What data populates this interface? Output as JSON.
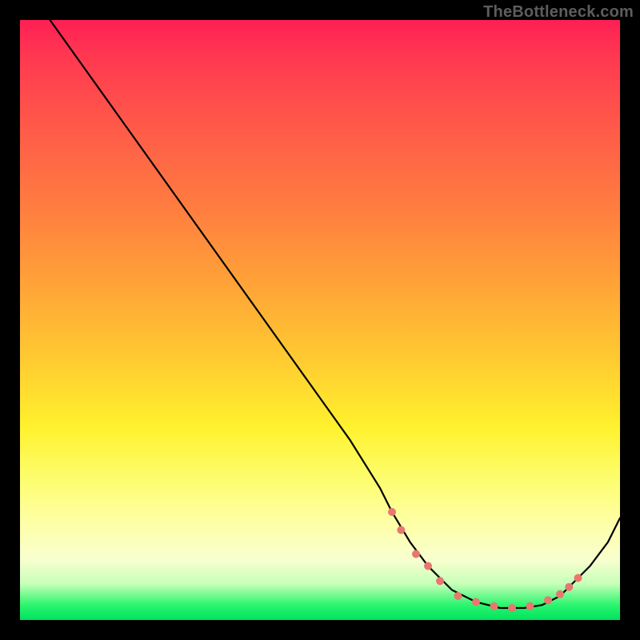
{
  "watermark": "TheBottleneck.com",
  "chart_data": {
    "type": "line",
    "title": "",
    "xlabel": "",
    "ylabel": "",
    "xlim": [
      0,
      100
    ],
    "ylim": [
      0,
      100
    ],
    "grid": false,
    "legend": null,
    "series": [
      {
        "name": "bottleneck-curve",
        "color": "#000000",
        "x": [
          5,
          10,
          15,
          20,
          25,
          30,
          35,
          40,
          45,
          50,
          55,
          60,
          62,
          65,
          68,
          72,
          76,
          80,
          84,
          87,
          90,
          92,
          95,
          98,
          100
        ],
        "y": [
          100,
          93,
          86,
          79,
          72,
          65,
          58,
          51,
          44,
          37,
          30,
          22,
          18,
          13,
          9,
          5,
          3,
          2,
          2,
          2.5,
          4,
          6,
          9,
          13,
          17
        ]
      }
    ],
    "markers": [
      {
        "name": "bottleneck-range-dots",
        "color": "#e8776f",
        "points": [
          {
            "x": 62,
            "y": 18
          },
          {
            "x": 63.5,
            "y": 15
          },
          {
            "x": 66,
            "y": 11
          },
          {
            "x": 68,
            "y": 9
          },
          {
            "x": 70,
            "y": 6.5
          },
          {
            "x": 73,
            "y": 4
          },
          {
            "x": 76,
            "y": 3
          },
          {
            "x": 79,
            "y": 2.3
          },
          {
            "x": 82,
            "y": 2
          },
          {
            "x": 85,
            "y": 2.3
          },
          {
            "x": 88,
            "y": 3.3
          },
          {
            "x": 90,
            "y": 4.3
          },
          {
            "x": 91.5,
            "y": 5.5
          },
          {
            "x": 93,
            "y": 7
          }
        ]
      }
    ],
    "background_gradient": {
      "orientation": "vertical",
      "stops": [
        {
          "pos": 0.0,
          "color": "#ff1f55"
        },
        {
          "pos": 0.32,
          "color": "#ff7f3f"
        },
        {
          "pos": 0.58,
          "color": "#ffcf30"
        },
        {
          "pos": 0.84,
          "color": "#feffa8"
        },
        {
          "pos": 0.97,
          "color": "#2bf56e"
        },
        {
          "pos": 1.0,
          "color": "#00e25e"
        }
      ]
    }
  }
}
